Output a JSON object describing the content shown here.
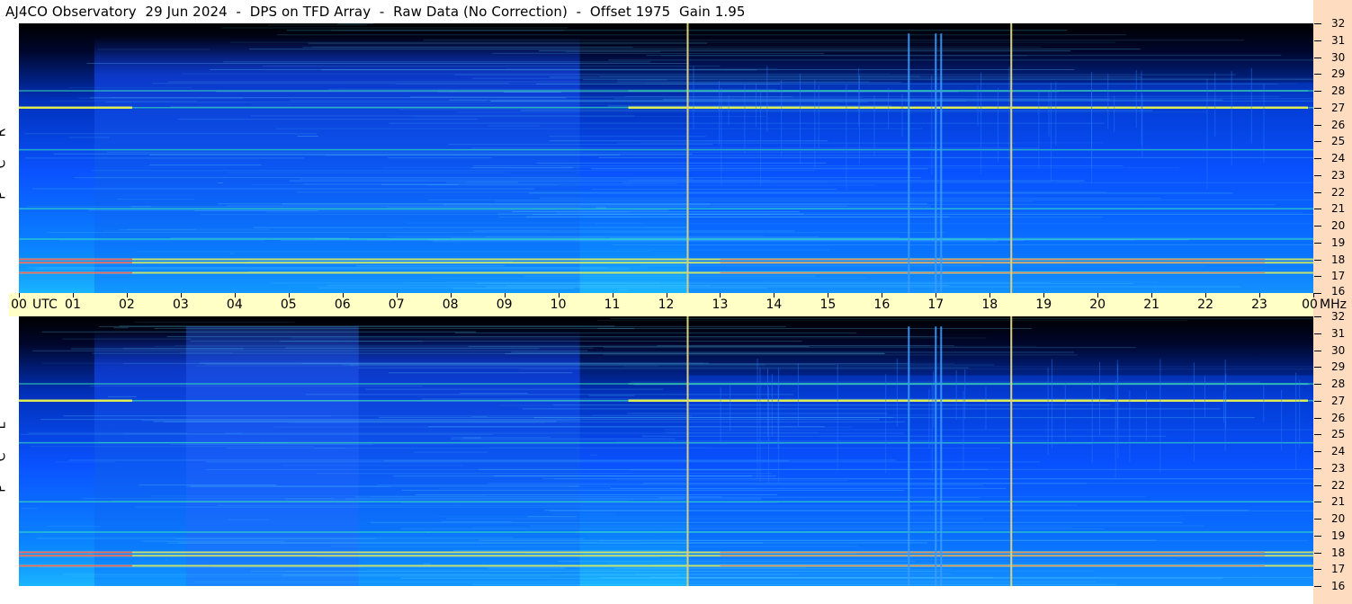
{
  "title": "AJ4CO Observatory  29 Jun 2024  -  DPS on TFD Array  -  Raw Data (No Correction)  -  Offset 1975  Gain 1.95",
  "colors": {
    "background": "#000000",
    "quiet_sky": "#0a52ff",
    "noise_high": "#19b4ff",
    "signal_mid": "#40ffb0",
    "signal_strong": "#ffff40",
    "signal_peak": "#ff4060",
    "time_bar": "#ffffc6",
    "freq_strip": "#fddcc0",
    "marker_line": "#d8d080"
  },
  "chart_data": [
    {
      "type": "heatmap",
      "panel": "RCP",
      "y_axis_label_letters": [
        "R",
        "C",
        "P"
      ],
      "x_label": "UTC",
      "y_label": "MHz",
      "x_range_hours": [
        0,
        24
      ],
      "y_range_mhz": [
        16,
        32
      ],
      "grid": false,
      "marker_times_utc_hours": [
        12.4,
        18.4
      ],
      "rfi_channels_mhz": [
        17.2,
        17.8,
        18.0,
        19.2,
        21.0,
        24.5,
        27.0,
        28.0
      ],
      "strong_spikes_utc_hours": [
        16.5,
        17.0,
        17.1
      ]
    },
    {
      "type": "heatmap",
      "panel": "LCP",
      "y_axis_label_letters": [
        "L",
        "C",
        "P"
      ],
      "x_label": "UTC",
      "y_label": "MHz",
      "x_range_hours": [
        0,
        24
      ],
      "y_range_mhz": [
        16,
        32
      ],
      "grid": false,
      "marker_times_utc_hours": [
        12.4,
        18.4
      ],
      "rfi_channels_mhz": [
        17.2,
        17.8,
        18.0,
        19.2,
        21.0,
        24.5,
        27.0,
        28.0
      ],
      "strong_spikes_utc_hours": [
        16.5,
        17.0,
        17.1
      ]
    }
  ],
  "time_axis": {
    "labels": [
      "00",
      "01",
      "02",
      "03",
      "04",
      "05",
      "06",
      "07",
      "08",
      "09",
      "10",
      "11",
      "12",
      "13",
      "14",
      "15",
      "16",
      "17",
      "18",
      "19",
      "20",
      "21",
      "22",
      "23",
      "00"
    ],
    "utc_label": "UTC",
    "mhz_label": "MHz"
  },
  "freq_axis": {
    "labels": [
      "32",
      "31",
      "30",
      "29",
      "28",
      "27",
      "26",
      "25",
      "24",
      "23",
      "22",
      "21",
      "20",
      "19",
      "18",
      "17",
      "16"
    ]
  }
}
